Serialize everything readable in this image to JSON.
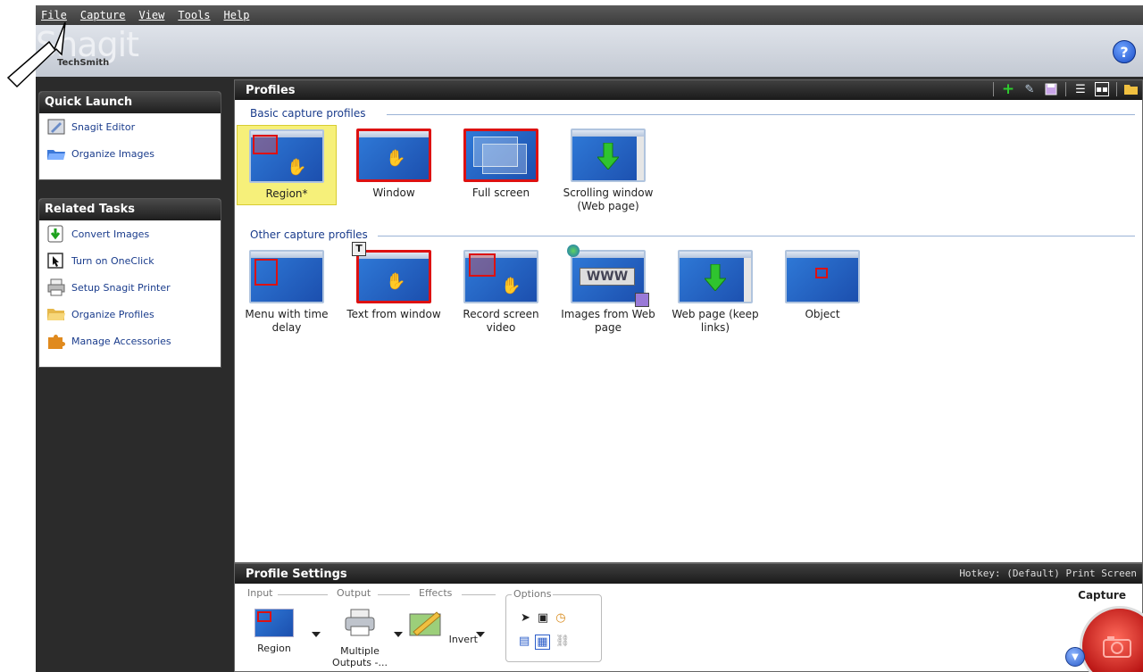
{
  "menu": [
    "File",
    "Capture",
    "View",
    "Tools",
    "Help"
  ],
  "logo": {
    "text": "Snagit",
    "sub": "TechSmith"
  },
  "quick_launch": {
    "title": "Quick Launch",
    "items": [
      "Snagit Editor",
      "Organize Images"
    ]
  },
  "related_tasks": {
    "title": "Related Tasks",
    "items": [
      "Convert Images",
      "Turn on OneClick",
      "Setup Snagit Printer",
      "Organize Profiles",
      "Manage Accessories"
    ]
  },
  "profiles": {
    "title": "Profiles",
    "basic_label": "Basic capture profiles",
    "basic": [
      {
        "label": "Region*",
        "selected": true
      },
      {
        "label": "Window"
      },
      {
        "label": "Full screen"
      },
      {
        "label": "Scrolling window (Web page)"
      }
    ],
    "other_label": "Other capture profiles",
    "other": [
      {
        "label": "Menu with time delay"
      },
      {
        "label": "Text from window"
      },
      {
        "label": "Record screen video"
      },
      {
        "label": "Images from Web page"
      },
      {
        "label": "Web page (keep links)"
      },
      {
        "label": "Object"
      }
    ]
  },
  "settings": {
    "title": "Profile Settings",
    "hotkey": "Hotkey: (Default) Print Screen",
    "groups": {
      "input": "Input",
      "output": "Output",
      "effects": "Effects",
      "options": "Options"
    },
    "input_value": "Region",
    "output_value": "Multiple Outputs -...",
    "effects_value": "Invert",
    "capture_label": "Capture"
  },
  "colors": {
    "accent_blue": "#1a3c8c",
    "selected_yellow": "#f6f07a",
    "capture_red": "#c81a1a"
  }
}
